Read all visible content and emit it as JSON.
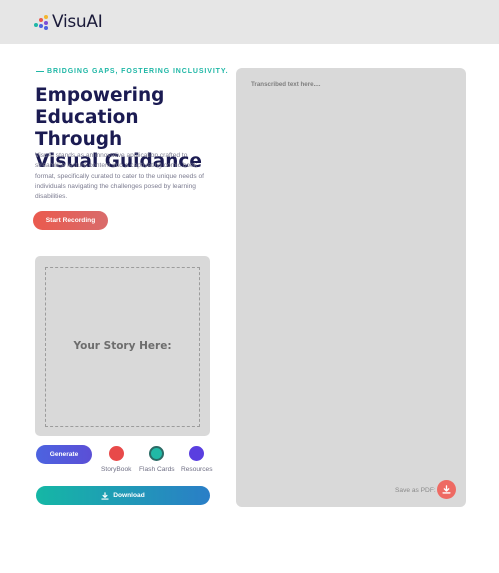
{
  "header": {
    "app_name": "VisuAI",
    "logo_colors": [
      "#1fb7a6",
      "#ea5a4e",
      "#4c63e0",
      "#f2b630",
      "#7a4fd6"
    ]
  },
  "hero": {
    "tagline": "BRIDGING GAPS, FOSTERING INCLUSIVITY.",
    "title_line1": "Empowering",
    "title_line2": "Education Through",
    "title_line3": "Visual Guidance",
    "description": "VisuAI stands as an innovative application crafted to streamline lecture content into a captivating comic book format, specifically curated to cater to the unique needs of individuals navigating the challenges posed by learning disabilities."
  },
  "actions": {
    "record_label": "Start Recording",
    "generate_label": "Generate",
    "download_label": "Download",
    "download_icon": "download-icon"
  },
  "story": {
    "placeholder": "Your Story Here:"
  },
  "options": [
    {
      "label": "StoryBook",
      "color": "#e84a4a"
    },
    {
      "label": "Flash Cards",
      "color": "#21b9a6"
    },
    {
      "label": "Resources",
      "color": "#5a3fe0"
    }
  ],
  "transcript": {
    "placeholder": "Transcribed text here....",
    "save_label": "Save as PDF:",
    "save_icon": "download-icon"
  },
  "colors": {
    "accent_teal": "#1fb7a6",
    "accent_red": "#ea5a4e",
    "accent_blue": "#4c63e0",
    "panel_grey": "#d9d9d9",
    "header_grey": "#e6e6e6"
  }
}
